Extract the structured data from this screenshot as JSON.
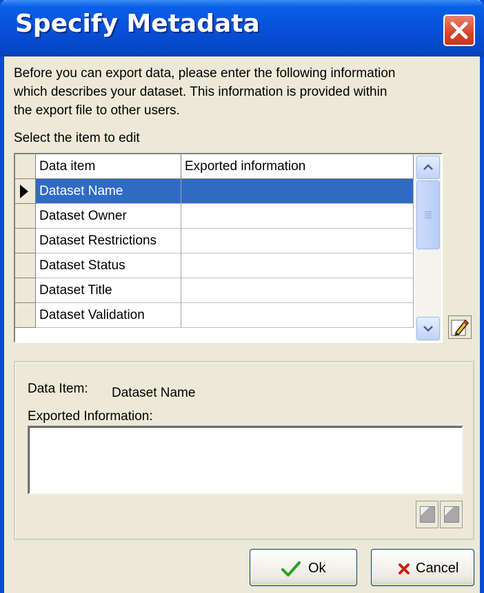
{
  "window": {
    "title": "Specify Metadata"
  },
  "intro": {
    "line1": "Before you can export data, please enter the following information",
    "line2": "which describes your dataset.  This information is provided within",
    "line3": "the export file to other users."
  },
  "select_label": "Select the item to edit",
  "grid": {
    "columns": [
      "Data item",
      "Exported information"
    ],
    "rows": [
      {
        "item": "Dataset Name",
        "value": "",
        "selected": true
      },
      {
        "item": "Dataset Owner",
        "value": ""
      },
      {
        "item": "Dataset Restrictions",
        "value": ""
      },
      {
        "item": "Dataset Status",
        "value": ""
      },
      {
        "item": "Dataset Title",
        "value": ""
      },
      {
        "item": "Dataset Validation",
        "value": ""
      }
    ]
  },
  "details": {
    "data_item_label": "Data Item:",
    "data_item_value": "Dataset Name",
    "exported_label": "Exported Information:",
    "exported_value": ""
  },
  "buttons": {
    "ok": "Ok",
    "cancel": "Cancel"
  },
  "colors": {
    "title_bar": "#0751d8",
    "selection": "#316ac5",
    "close": "#d8452a",
    "ok_check": "#2aa02a",
    "cancel_x": "#d02010"
  },
  "icons": {
    "close": "close-x-icon",
    "edit": "pencil-edit-icon",
    "ok": "checkmark-icon",
    "cancel": "red-x-icon"
  }
}
